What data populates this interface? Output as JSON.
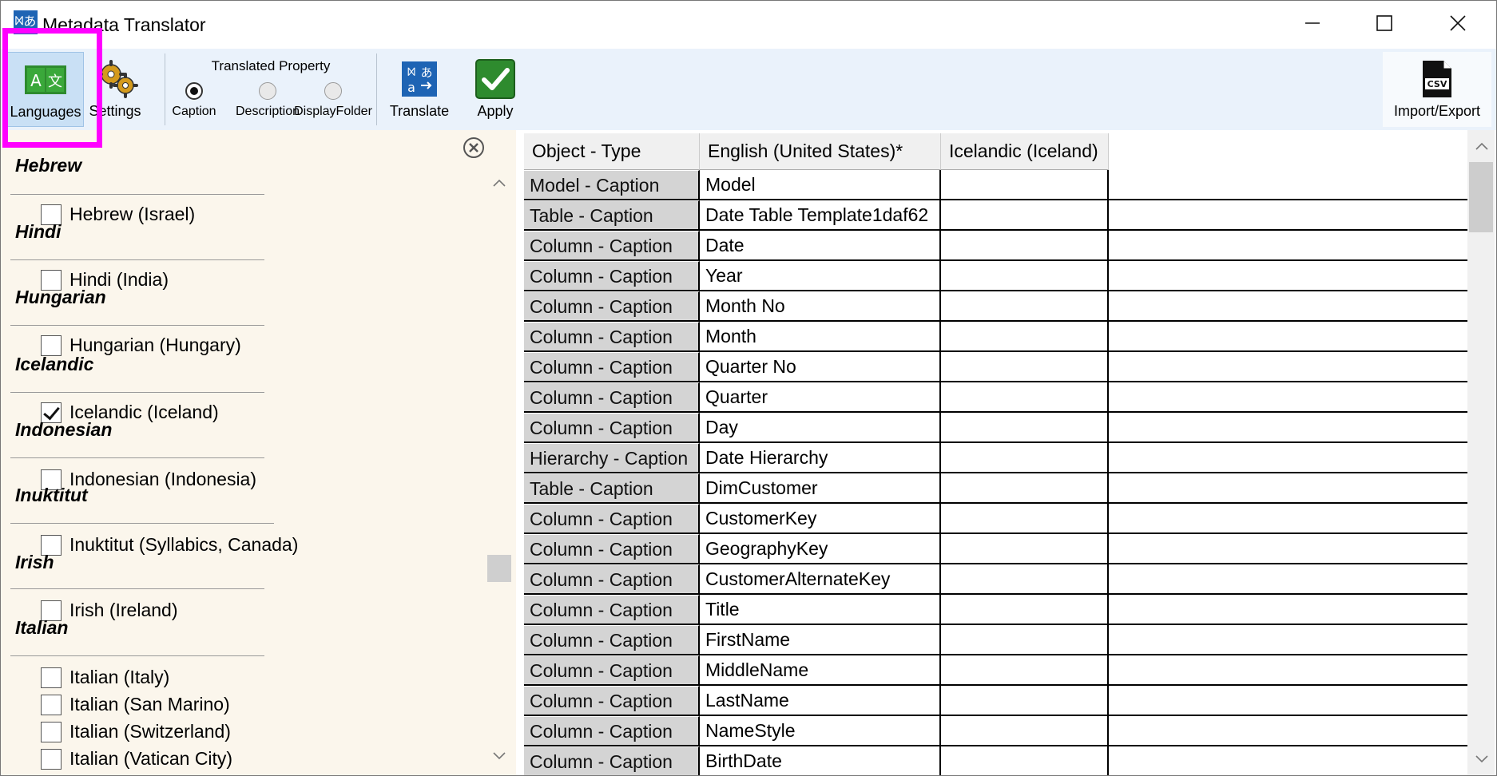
{
  "window": {
    "title": "Metadata Translator",
    "icon": "translate-app-icon",
    "icon_glyph": "ᢂあ"
  },
  "ribbon": {
    "languages_label": "Languages",
    "settings_label": "Settings",
    "translated_property": {
      "title": "Translated Property",
      "options": [
        "Caption",
        "Description",
        "DisplayFolder"
      ],
      "selected": "Caption"
    },
    "translate_label": "Translate",
    "apply_label": "Apply",
    "import_export_label": "Import/Export",
    "csv_badge": "CSV"
  },
  "colors": {
    "highlight": "#ff00ff",
    "ribbon_bg": "#eaf2fb",
    "panel_bg": "#fbf6ec",
    "apply_green": "#2e8b2e",
    "translate_blue": "#1e64b4"
  },
  "language_panel": {
    "groups": [
      {
        "name": "Hebrew",
        "items": [
          {
            "label": "Hebrew (Israel)",
            "checked": false
          }
        ]
      },
      {
        "name": "Hindi",
        "items": [
          {
            "label": "Hindi (India)",
            "checked": false
          }
        ]
      },
      {
        "name": "Hungarian",
        "items": [
          {
            "label": "Hungarian (Hungary)",
            "checked": false
          }
        ]
      },
      {
        "name": "Icelandic",
        "items": [
          {
            "label": "Icelandic (Iceland)",
            "checked": true
          }
        ]
      },
      {
        "name": "Indonesian",
        "items": [
          {
            "label": "Indonesian (Indonesia)",
            "checked": false
          }
        ]
      },
      {
        "name": "Inuktitut",
        "items": [
          {
            "label": "Inuktitut (Syllabics, Canada)",
            "checked": false
          }
        ]
      },
      {
        "name": "Irish",
        "items": [
          {
            "label": "Irish (Ireland)",
            "checked": false
          }
        ]
      },
      {
        "name": "Italian",
        "items": [
          {
            "label": "Italian (Italy)",
            "checked": false
          },
          {
            "label": "Italian (San Marino)",
            "checked": false
          },
          {
            "label": "Italian (Switzerland)",
            "checked": false
          },
          {
            "label": "Italian (Vatican City)",
            "checked": false
          }
        ]
      }
    ]
  },
  "grid": {
    "columns": [
      "Object - Type",
      "English (United States)*",
      "Icelandic (Iceland)"
    ],
    "rows": [
      {
        "type": "Model - Caption",
        "english": "Model",
        "icelandic": ""
      },
      {
        "type": "Table - Caption",
        "english": "Date Table Template1daf62",
        "icelandic": ""
      },
      {
        "type": "Column - Caption",
        "english": "Date",
        "icelandic": ""
      },
      {
        "type": "Column - Caption",
        "english": "Year",
        "icelandic": ""
      },
      {
        "type": "Column - Caption",
        "english": "Month No",
        "icelandic": ""
      },
      {
        "type": "Column - Caption",
        "english": "Month",
        "icelandic": ""
      },
      {
        "type": "Column - Caption",
        "english": "Quarter No",
        "icelandic": ""
      },
      {
        "type": "Column - Caption",
        "english": "Quarter",
        "icelandic": ""
      },
      {
        "type": "Column - Caption",
        "english": "Day",
        "icelandic": ""
      },
      {
        "type": "Hierarchy - Caption",
        "english": "Date Hierarchy",
        "icelandic": ""
      },
      {
        "type": "Table - Caption",
        "english": "DimCustomer",
        "icelandic": ""
      },
      {
        "type": "Column - Caption",
        "english": "CustomerKey",
        "icelandic": ""
      },
      {
        "type": "Column - Caption",
        "english": "GeographyKey",
        "icelandic": ""
      },
      {
        "type": "Column - Caption",
        "english": "CustomerAlternateKey",
        "icelandic": ""
      },
      {
        "type": "Column - Caption",
        "english": "Title",
        "icelandic": ""
      },
      {
        "type": "Column - Caption",
        "english": "FirstName",
        "icelandic": ""
      },
      {
        "type": "Column - Caption",
        "english": "MiddleName",
        "icelandic": ""
      },
      {
        "type": "Column - Caption",
        "english": "LastName",
        "icelandic": ""
      },
      {
        "type": "Column - Caption",
        "english": "NameStyle",
        "icelandic": ""
      },
      {
        "type": "Column - Caption",
        "english": "BirthDate",
        "icelandic": ""
      }
    ]
  }
}
